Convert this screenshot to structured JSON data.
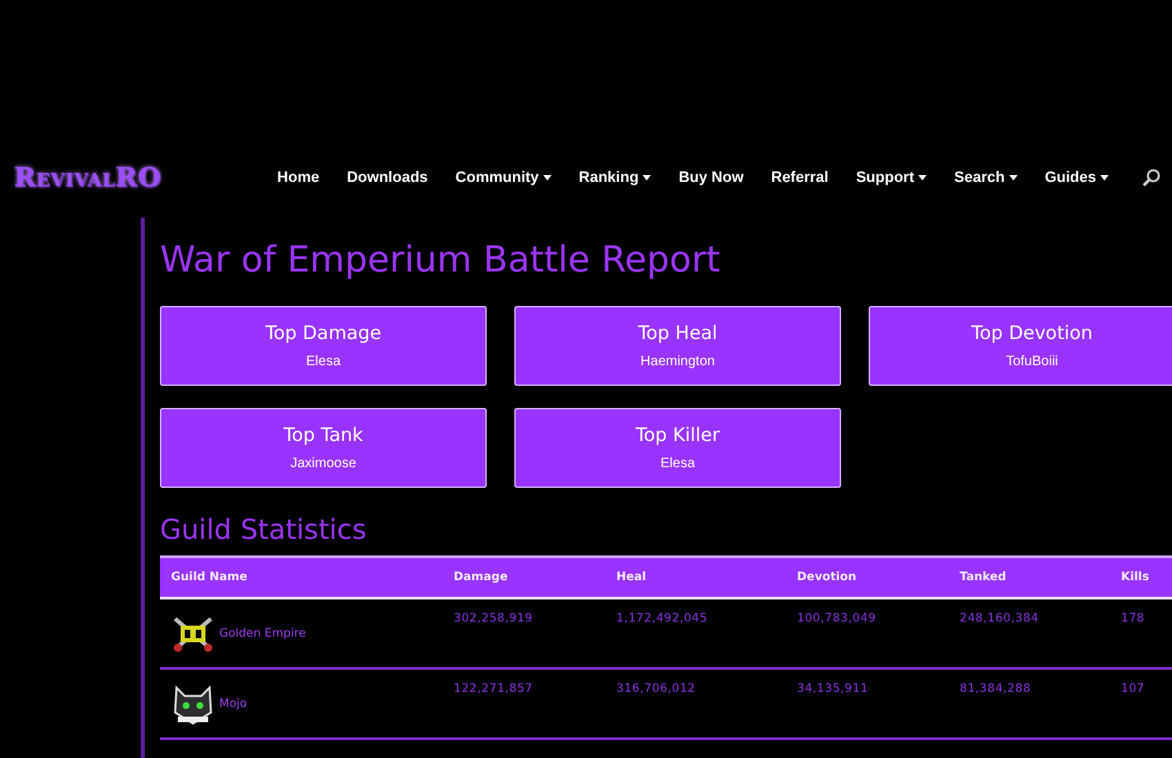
{
  "logo": "RevivalRO",
  "nav": [
    {
      "label": "Home",
      "dropdown": false
    },
    {
      "label": "Downloads",
      "dropdown": false
    },
    {
      "label": "Community",
      "dropdown": true
    },
    {
      "label": "Ranking",
      "dropdown": true
    },
    {
      "label": "Buy Now",
      "dropdown": false
    },
    {
      "label": "Referral",
      "dropdown": false
    },
    {
      "label": "Support",
      "dropdown": true
    },
    {
      "label": "Search",
      "dropdown": true
    },
    {
      "label": "Guides",
      "dropdown": true
    }
  ],
  "title": "War of Emperium Battle Report",
  "awards": [
    {
      "title": "Top Damage",
      "name": "Elesa"
    },
    {
      "title": "Top Heal",
      "name": "Haemington"
    },
    {
      "title": "Top Devotion",
      "name": "TofuBoiii"
    },
    {
      "title": "Top Tank",
      "name": "Jaximoose"
    },
    {
      "title": "Top Killer",
      "name": "Elesa"
    }
  ],
  "guild_section": {
    "title": "Guild Statistics",
    "columns": [
      "Guild Name",
      "Damage",
      "Heal",
      "Devotion",
      "Tanked",
      "Kills"
    ],
    "rows": [
      {
        "kind": "crossed",
        "cells": [
          "Golden Empire",
          "302,258,919",
          "1,172,492,045",
          "100,783,049",
          "248,160,384",
          "178"
        ]
      },
      {
        "kind": "cat",
        "cells": [
          "Mojo",
          "122,271,857",
          "316,706,012",
          "34,135,911",
          "81,384,288",
          "107"
        ]
      }
    ]
  }
}
